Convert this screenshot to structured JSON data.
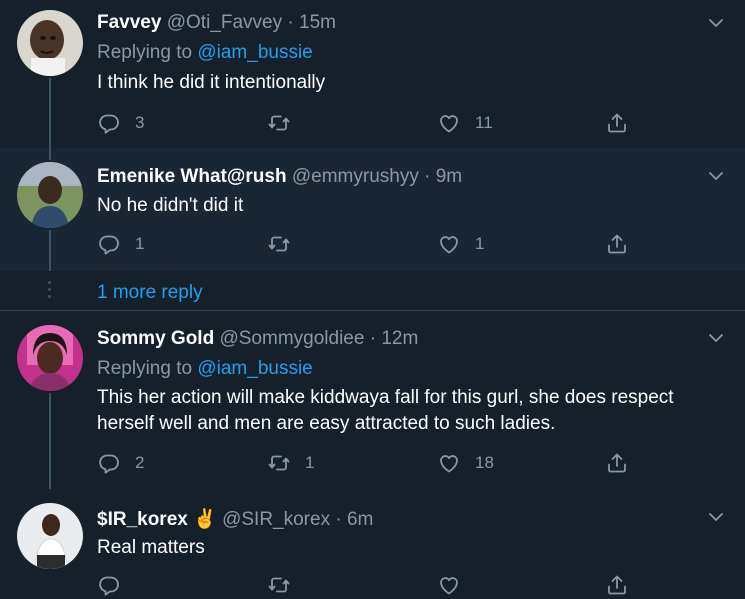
{
  "tweets": [
    {
      "name": "Favvey",
      "handle": "@Oti_Favvey",
      "time": "15m",
      "replying_label": "Replying to",
      "replying_handle": "@iam_bussie",
      "text": "I think he did it intentionally",
      "replies": "3",
      "retweets": "",
      "likes": "11"
    },
    {
      "name": "Emenike What@rush",
      "handle": "@emmyrushyy",
      "time": "9m",
      "text": "No he didn't did it",
      "replies": "1",
      "retweets": "",
      "likes": "1"
    },
    {
      "name": "Sommy Gold",
      "handle": "@Sommygoldiee",
      "time": "12m",
      "replying_label": "Replying to",
      "replying_handle": "@iam_bussie",
      "text": "This her action will make kiddwaya fall for this gurl, she does respect herself well and men are easy attracted to such ladies.",
      "replies": "2",
      "retweets": "1",
      "likes": "18"
    },
    {
      "name": "$IR_korex",
      "name_emoji": "✌",
      "handle": "@SIR_korex",
      "time": "6m",
      "text": "Real matters",
      "replies": "",
      "retweets": "",
      "likes": ""
    }
  ],
  "more_replies": "1 more reply",
  "separator": "·",
  "colors": {
    "background": "#15202b",
    "highlight": "#192734",
    "muted": "#8899a6",
    "link": "#1da1f2",
    "divider": "#38444d"
  }
}
